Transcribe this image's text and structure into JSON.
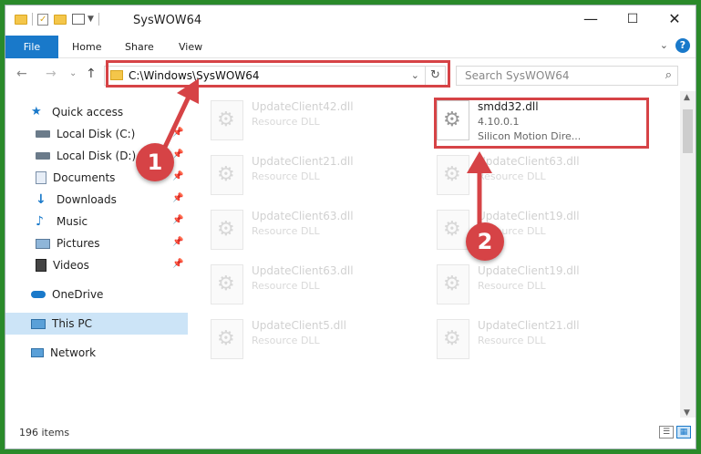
{
  "window": {
    "title": "SysWOW64",
    "minimize": "—",
    "maximize": "☐",
    "close": "✕"
  },
  "ribbon": {
    "tabs": [
      "File",
      "Home",
      "Share",
      "View"
    ],
    "help": "?",
    "expand": "⌄"
  },
  "address": {
    "path": "C:\\Windows\\SysWOW64",
    "dropdown": "⌄",
    "refresh": "↻"
  },
  "search": {
    "placeholder": "Search SysWOW64",
    "icon": "⌕"
  },
  "nav": {
    "back": "←",
    "forward": "→",
    "recent": "⌄",
    "up": "↑"
  },
  "sidebar": {
    "items": [
      {
        "label": "Quick access",
        "icon": "star-icon"
      },
      {
        "label": "Local Disk (C:)",
        "icon": "drive-icon"
      },
      {
        "label": "Local Disk (D:)",
        "icon": "drive-icon"
      },
      {
        "label": "Documents",
        "icon": "documents-icon"
      },
      {
        "label": "Downloads",
        "icon": "download-icon"
      },
      {
        "label": "Music",
        "icon": "music-icon"
      },
      {
        "label": "Pictures",
        "icon": "pictures-icon"
      },
      {
        "label": "Videos",
        "icon": "videos-icon"
      },
      {
        "label": "OneDrive",
        "icon": "cloud-icon"
      },
      {
        "label": "This PC",
        "icon": "computer-icon"
      },
      {
        "label": "Network",
        "icon": "network-icon"
      }
    ]
  },
  "files": {
    "left": [
      {
        "name": "UpdateClient42.dll",
        "desc": "Resource DLL"
      },
      {
        "name": "UpdateClient21.dll",
        "desc": "Resource DLL"
      },
      {
        "name": "UpdateClient63.dll",
        "desc": "Resource DLL"
      },
      {
        "name": "UpdateClient63.dll",
        "desc": "Resource DLL"
      },
      {
        "name": "UpdateClient5.dll",
        "desc": "Resource DLL"
      }
    ],
    "right": [
      {
        "name": "UpdateClient63.dll",
        "desc": "Resource DLL"
      },
      {
        "name": "UpdateClient19.dll",
        "desc": "Resource DLL"
      },
      {
        "name": "UpdateClient19.dll",
        "desc": "Resource DLL"
      },
      {
        "name": "UpdateClient21.dll",
        "desc": "Resource DLL"
      }
    ],
    "highlighted": {
      "name": "smdd32.dll",
      "version": "4.10.0.1",
      "desc": "Silicon Motion Dire..."
    }
  },
  "status": {
    "count": "196 items"
  },
  "annotations": {
    "step1": "1",
    "step2": "2",
    "color": "#d64346"
  },
  "colors": {
    "accent": "#1979ca",
    "highlight_box": "#d64346"
  }
}
